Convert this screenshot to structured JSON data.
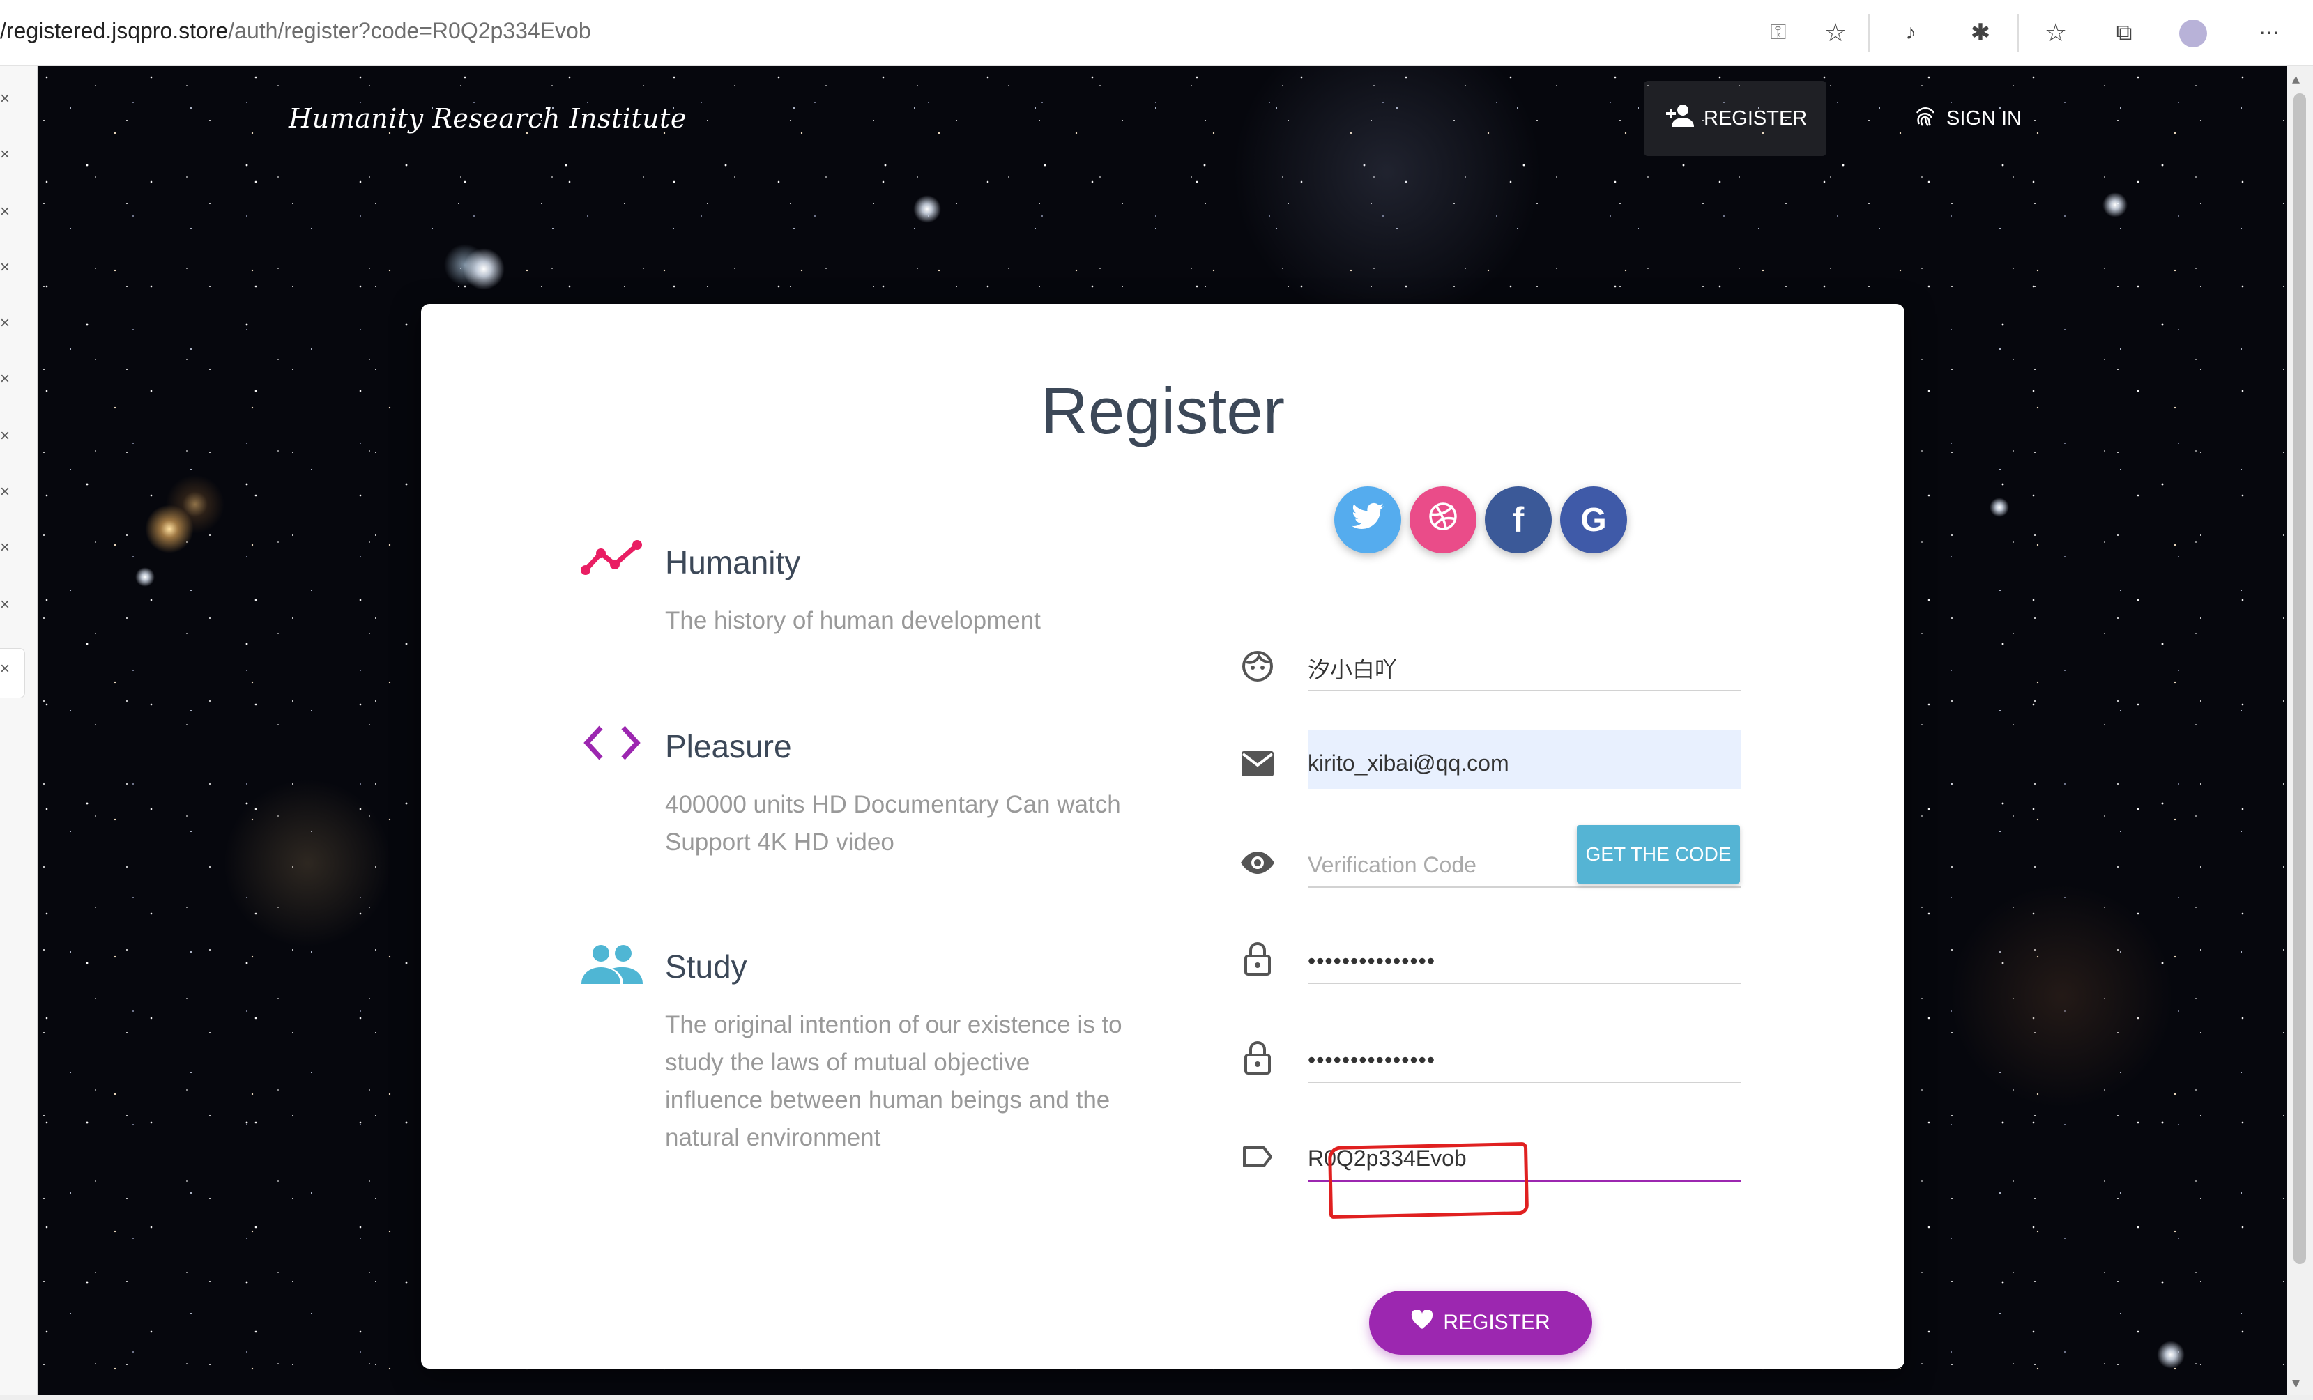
{
  "browser": {
    "url_host": "/registered.jsqpro.store",
    "url_path": "/auth/register?code=R0Q2p334Evob"
  },
  "nav": {
    "brand": "Humanity Research Institute",
    "register_label": "REGISTER",
    "signin_label": "SIGN IN"
  },
  "card": {
    "title": "Register",
    "features": [
      {
        "title": "Humanity",
        "desc": "The history of human development",
        "color": "#e91e63"
      },
      {
        "title": "Pleasure",
        "desc": "400000 units HD Documentary Can watch Support 4K HD video",
        "color": "#9c27b0"
      },
      {
        "title": "Study",
        "desc": "The original intention of our existence is to study the laws of mutual objective influence between human beings and the natural environment",
        "color": "#00bcd4"
      }
    ],
    "social": [
      {
        "icon": "twitter-icon",
        "glyph": "🐦",
        "color": "#55acee"
      },
      {
        "icon": "dribbble-icon",
        "glyph": "◎",
        "color": "#ea4c89"
      },
      {
        "icon": "facebook-icon",
        "glyph": "f",
        "color": "#3b5998"
      },
      {
        "icon": "google-icon",
        "glyph": "G",
        "color": "#3f5aa8"
      }
    ],
    "form": {
      "username": "汐小白吖",
      "email": "kirito_xibai@qq.com",
      "verification_placeholder": "Verification Code",
      "get_code_label": "GET THE CODE",
      "password": "•••••••••••••••",
      "password_confirm": "•••••••••••••••",
      "invite_code": "R0Q2p334Evob",
      "submit_label": "REGISTER"
    },
    "accent": "#9c27b0",
    "highlight_color": "#e02020"
  }
}
